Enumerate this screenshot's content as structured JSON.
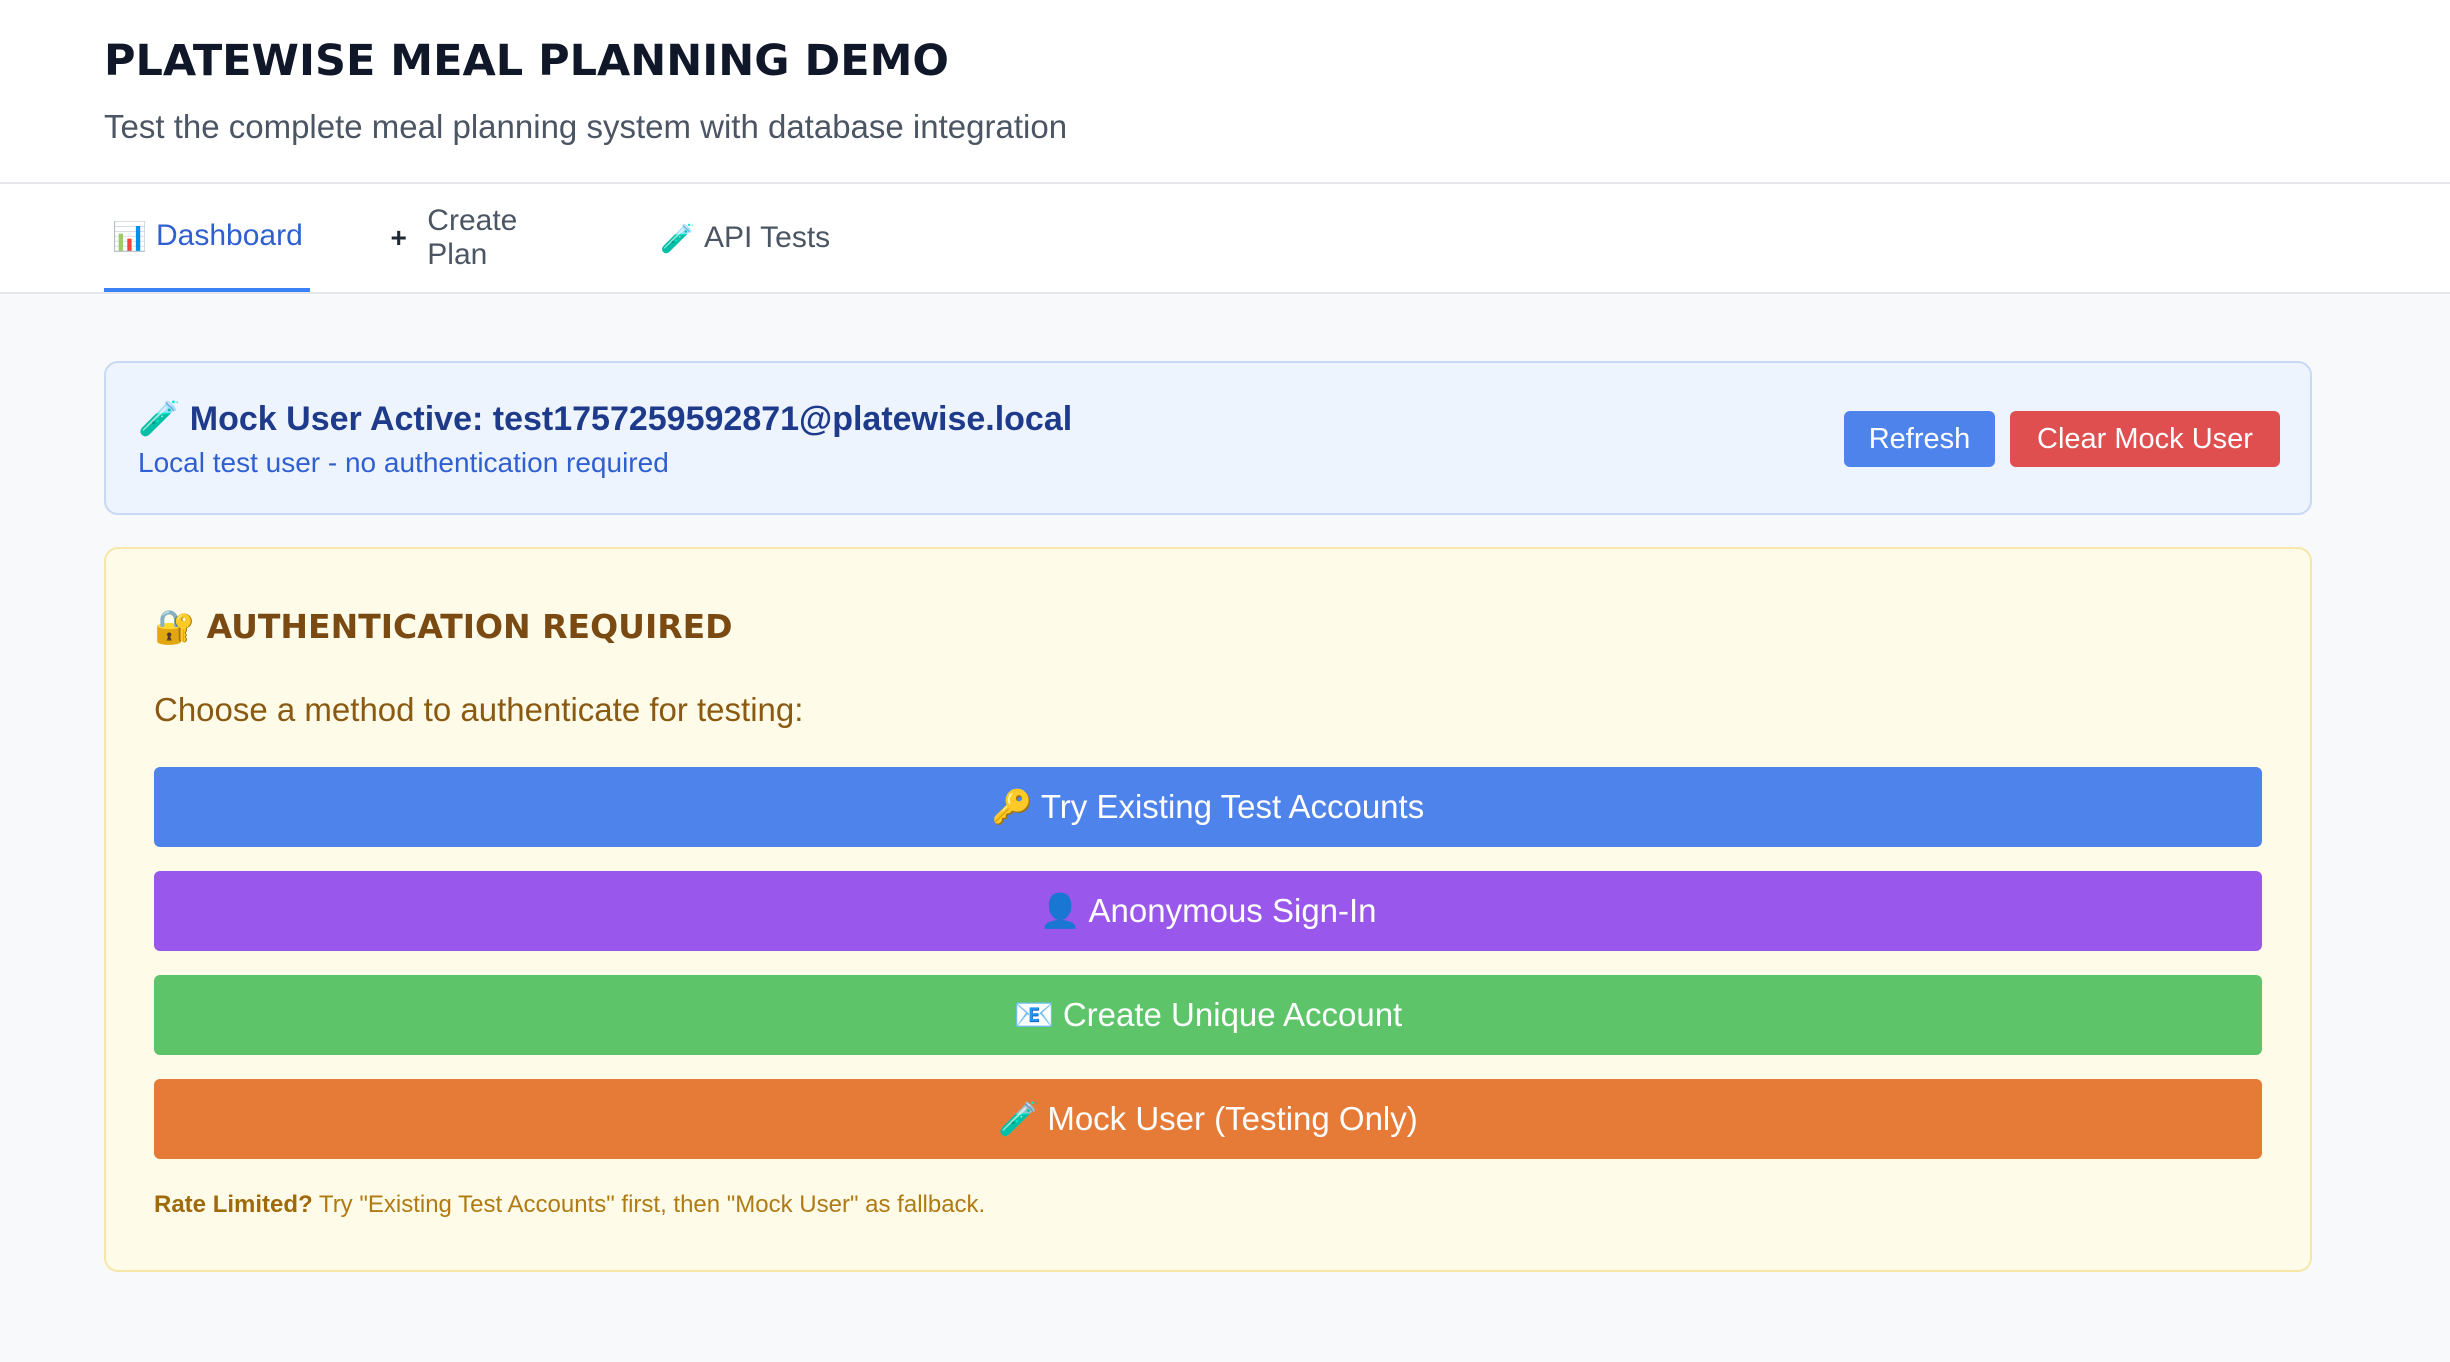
{
  "header": {
    "title": "PLATEWISE MEAL PLANNING DEMO",
    "subtitle": "Test the complete meal planning system with database integration"
  },
  "tabs": [
    {
      "icon": "📊",
      "label": "Dashboard",
      "active": true
    },
    {
      "icon": "+",
      "label": "Create Plan",
      "active": false
    },
    {
      "icon": "🧪",
      "label": "API Tests",
      "active": false
    }
  ],
  "mock_banner": {
    "icon": "🧪",
    "title": "Mock User Active: test1757259592871@platewise.local",
    "subtitle": "Local test user - no authentication required",
    "refresh_label": "Refresh",
    "clear_label": "Clear Mock User"
  },
  "auth": {
    "icon": "🔐",
    "title": "AUTHENTICATION REQUIRED",
    "prompt": "Choose a method to authenticate for testing:",
    "buttons": [
      {
        "icon": "🔑",
        "label": "Try Existing Test Accounts",
        "color": "#4f83ec"
      },
      {
        "icon": "👤",
        "label": "Anonymous Sign-In",
        "color": "#9a57ec"
      },
      {
        "icon": "📧",
        "label": "Create Unique Account",
        "color": "#5ec46a"
      },
      {
        "icon": "🧪",
        "label": "Mock User (Testing Only)",
        "color": "#e67b37"
      }
    ],
    "note_bold": "Rate Limited?",
    "note_text": " Try \"Existing Test Accounts\" first, then \"Mock User\" as fallback."
  },
  "colors": {
    "accent": "#3b82f6",
    "danger": "#df4f4f",
    "banner_bg": "#eef4fd",
    "auth_bg": "#fefce8"
  }
}
